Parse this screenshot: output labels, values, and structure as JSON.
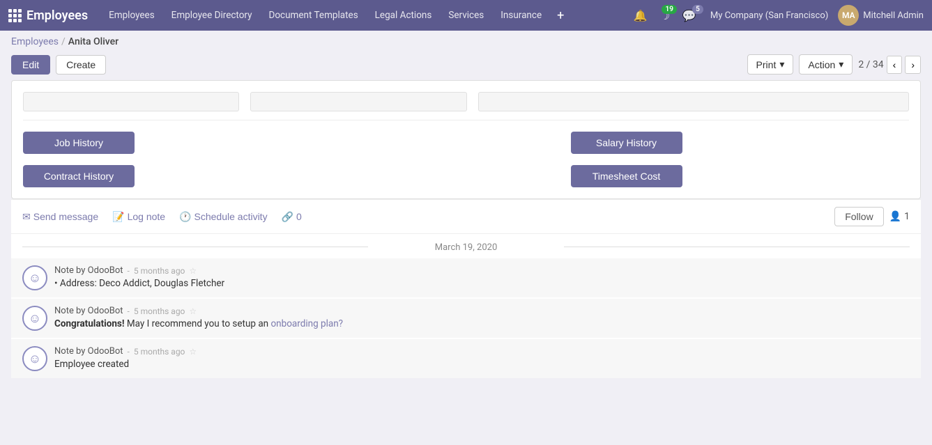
{
  "topnav": {
    "brand": "Employees",
    "links": [
      "Employees",
      "Employee Directory",
      "Document Templates",
      "Legal Actions",
      "Services",
      "Insurance"
    ],
    "plus_label": "+",
    "notifications_count": "19",
    "messages_count": "5",
    "company": "My Company (San Francisco)",
    "user": "Mitchell Admin"
  },
  "breadcrumb": {
    "parent": "Employees",
    "separator": "/",
    "current": "Anita Oliver"
  },
  "toolbar": {
    "edit_label": "Edit",
    "create_label": "Create",
    "print_label": "Print",
    "action_label": "Action",
    "pager": "2 / 34"
  },
  "stat_buttons": {
    "job_history": "Job History",
    "salary_history": "Salary History",
    "contract_history": "Contract History",
    "timesheet_cost": "Timesheet Cost"
  },
  "chatter": {
    "send_message": "Send message",
    "log_note": "Log note",
    "schedule_activity": "Schedule activity",
    "link_count": "0",
    "follow_label": "Follow",
    "followers_count": "1",
    "date_separator": "March 19, 2020",
    "notes": [
      {
        "author": "Note by OdooBot",
        "time": "5 months ago",
        "body_prefix": "•",
        "body": " Address: Deco Addict, Douglas Fletcher",
        "has_link": false
      },
      {
        "author": "Note by OdooBot",
        "time": "5 months ago",
        "body_bold": "Congratulations!",
        "body": " May I recommend you to setup an ",
        "link_text": "onboarding plan?",
        "has_link": true
      },
      {
        "author": "Note by OdooBot",
        "time": "5 months ago",
        "body": "Employee created",
        "has_link": false
      }
    ]
  }
}
